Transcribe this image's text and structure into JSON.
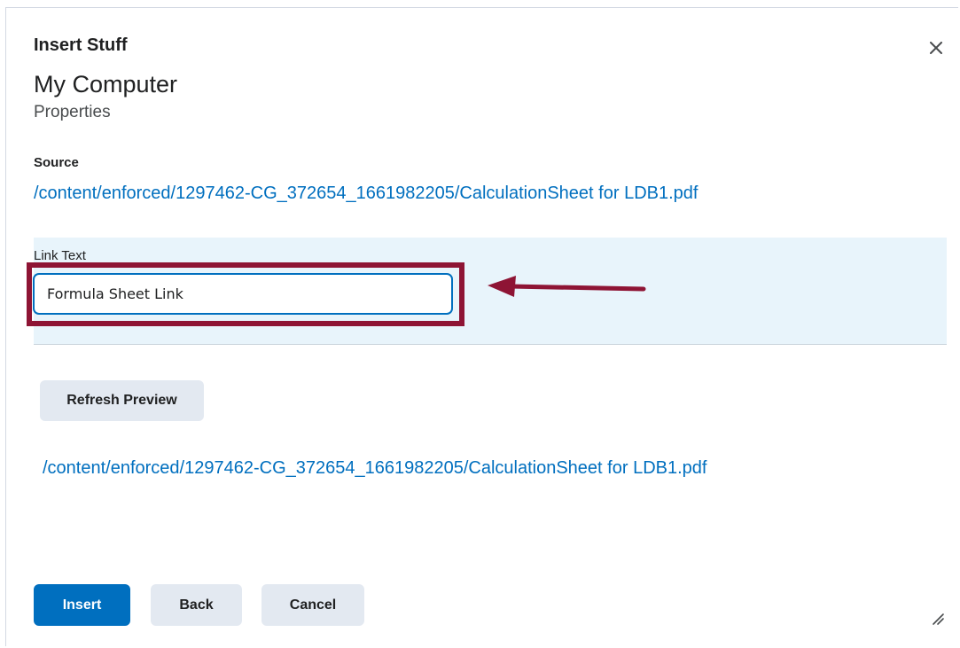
{
  "dialog": {
    "title": "Insert Stuff",
    "subtitle": "My Computer",
    "section": "Properties",
    "close_icon": "close-icon"
  },
  "source": {
    "label": "Source",
    "path": "/content/enforced/1297462-CG_372654_1661982205/CalculationSheet for LDB1.pdf"
  },
  "link_text": {
    "label": "Link Text",
    "value": "Formula Sheet Link"
  },
  "refresh_button": "Refresh Preview",
  "preview": {
    "link": "/content/enforced/1297462-CG_372654_1661982205/CalculationSheet for LDB1.pdf"
  },
  "footer": {
    "insert_label": "Insert",
    "back_label": "Back",
    "cancel_label": "Cancel"
  },
  "annotation": {
    "color": "#8e1434",
    "arrow_icon": "arrow-left-icon"
  },
  "colors": {
    "primary": "#006fbf",
    "highlight_bg": "#e8f4fb",
    "secondary_button": "#e3e9f1"
  }
}
